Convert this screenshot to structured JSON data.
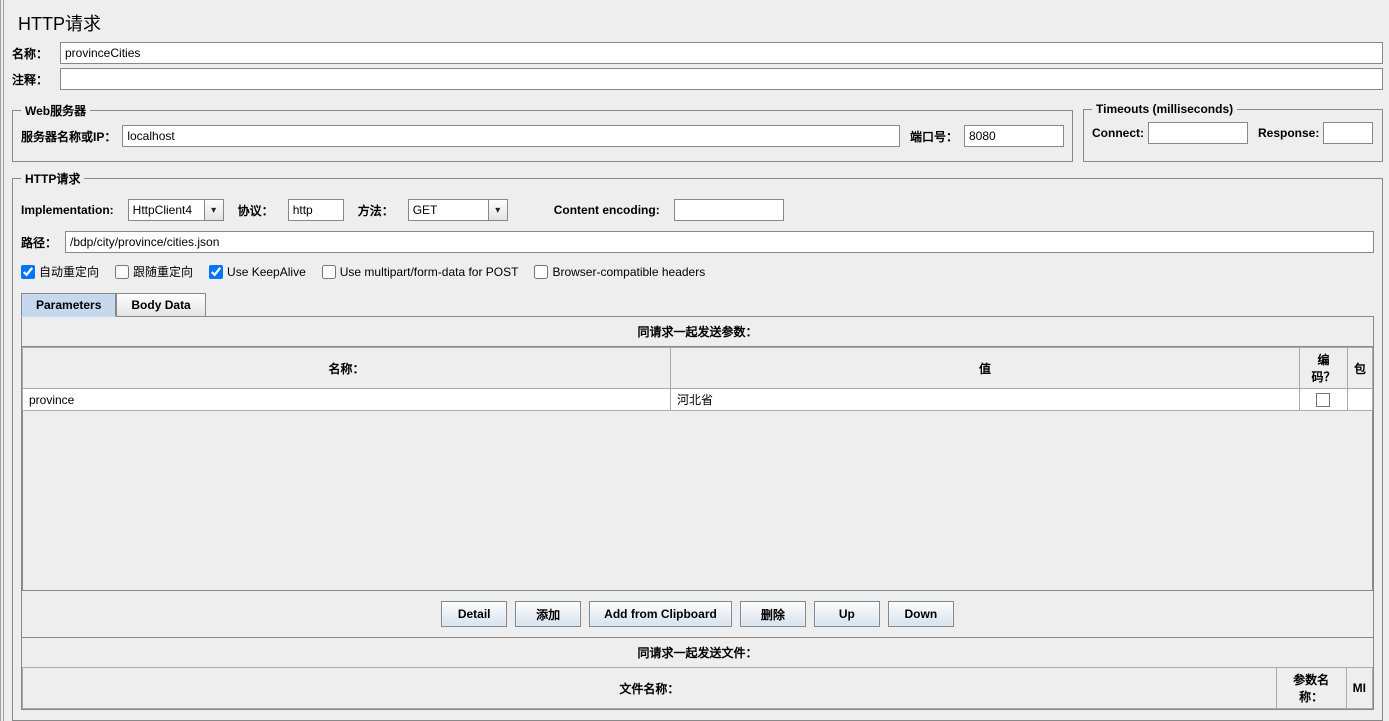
{
  "page_title": "HTTP请求",
  "name_label": "名称：",
  "name_value": "provinceCities",
  "comment_label": "注释：",
  "comment_value": "",
  "webserver": {
    "legend": "Web服务器",
    "server_label": "服务器名称或IP：",
    "server_value": "localhost",
    "port_label": "端口号：",
    "port_value": "8080"
  },
  "timeouts": {
    "legend": "Timeouts (milliseconds)",
    "connect_label": "Connect:",
    "connect_value": "",
    "response_label": "Response:",
    "response_value": ""
  },
  "request": {
    "legend": "HTTP请求",
    "impl_label": "Implementation:",
    "impl_value": "HttpClient4",
    "protocol_label": "协议：",
    "protocol_value": "http",
    "method_label": "方法：",
    "method_value": "GET",
    "encoding_label": "Content encoding:",
    "encoding_value": "",
    "path_label": "路径：",
    "path_value": "/bdp/city/province/cities.json",
    "checks": {
      "auto_redirect": "自动重定向",
      "follow_redirect": "跟随重定向",
      "keepalive": "Use KeepAlive",
      "multipart": "Use multipart/form-data for POST",
      "browser_compat": "Browser-compatible headers"
    }
  },
  "tabs": {
    "parameters": "Parameters",
    "bodydata": "Body Data"
  },
  "params": {
    "title": "同请求一起发送参数：",
    "col_name": "名称：",
    "col_value": "值",
    "col_encode": "编码？",
    "col_include": "包",
    "rows": [
      {
        "name": "province",
        "value": "河北省"
      }
    ]
  },
  "buttons": {
    "detail": "Detail",
    "add": "添加",
    "clipboard": "Add from Clipboard",
    "delete": "删除",
    "up": "Up",
    "down": "Down"
  },
  "files": {
    "title": "同请求一起发送文件：",
    "col_filename": "文件名称：",
    "col_paramname": "参数名称：",
    "col_mime": "MI"
  }
}
